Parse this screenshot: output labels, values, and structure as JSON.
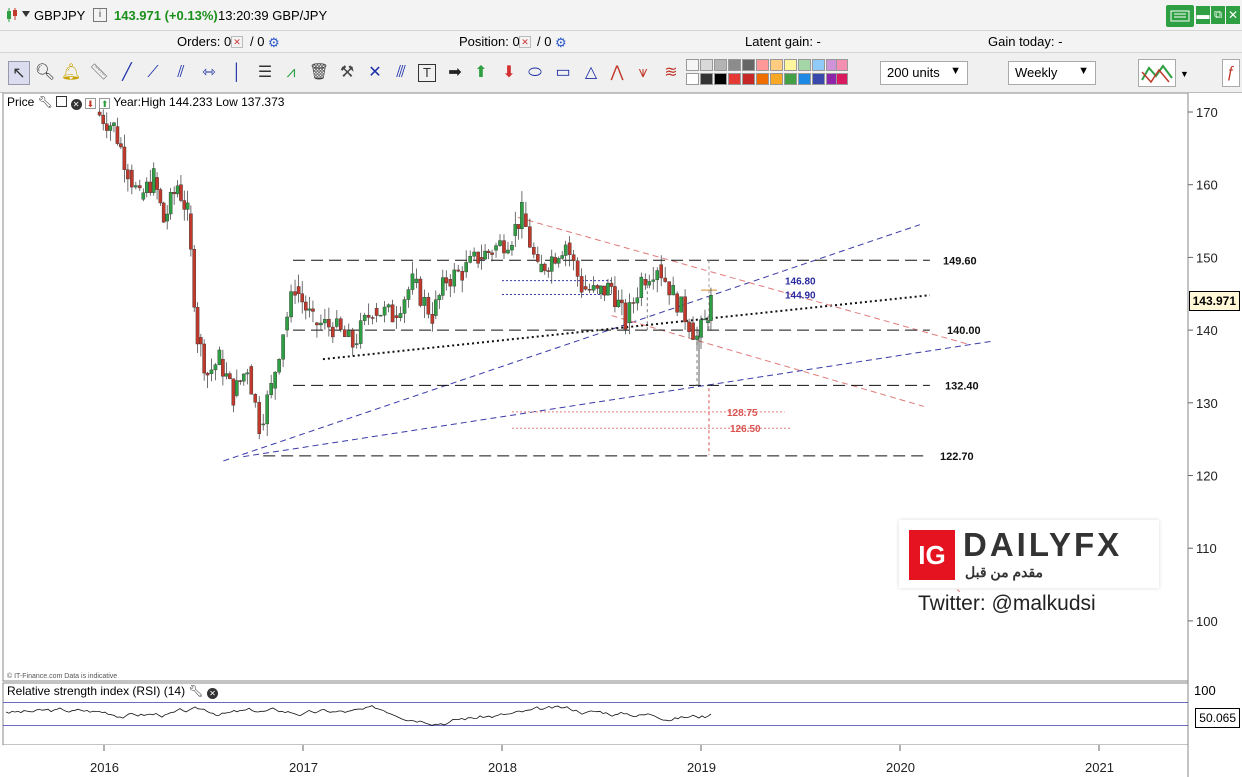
{
  "header": {
    "symbol": "GBPJPY",
    "price_change": "143.971 (+0.13%)",
    "time": "13:20:39 GBP/JPY"
  },
  "infobar": {
    "orders_label": "Orders: 0",
    "orders_sep": "/ 0",
    "position_label": "Position: 0",
    "position_sep": "/ 0",
    "latent_gain": "Latent gain: -",
    "gain_today": "Gain today: -"
  },
  "toolbar": {
    "units_select": "200 units",
    "period_select": "Weekly"
  },
  "price_panel": {
    "label": "Price",
    "year_stats": "Year:High 144.233 Low 137.373",
    "credit": "© IT-Finance.com  Data is indicative",
    "current_price": "143.971"
  },
  "rsi_panel": {
    "label": "Relative strength index (RSI) (14)",
    "axis_top": "100",
    "current_value": "50.065"
  },
  "watermark": {
    "ig": "IG",
    "brand": "DAILYFX",
    "subtitle": "مقدم من قبل",
    "twitter": "Twitter: @malkudsi"
  },
  "colors": {
    "up_candle": "#2ea043",
    "down_candle": "#c0392b",
    "trend_blue": "#3a3aa8",
    "channel_red": "#e07b7b",
    "accent_green": "#1a8f1a"
  },
  "chart_data": {
    "type": "candlestick",
    "symbol": "GBPJPY",
    "timeframe": "Weekly",
    "x_tick_labels": [
      "2016",
      "2017",
      "2018",
      "2019",
      "2020",
      "2021"
    ],
    "y_tick_labels": [
      170,
      160,
      150,
      140,
      130,
      120,
      110,
      100
    ],
    "ylim": [
      96,
      172
    ],
    "current_price": 143.971,
    "horizontal_levels": [
      {
        "label": "149.60",
        "value": 149.6,
        "style": "dashed-black"
      },
      {
        "label": "146.80",
        "value": 146.8,
        "style": "dotted-blue"
      },
      {
        "label": "144.90",
        "value": 144.9,
        "style": "dotted-blue"
      },
      {
        "label": "140.00",
        "value": 140.0,
        "style": "dashed-black"
      },
      {
        "label": "132.40",
        "value": 132.4,
        "style": "dashed-black"
      },
      {
        "label": "128.75",
        "value": 128.75,
        "style": "dotted-red"
      },
      {
        "label": "126.50",
        "value": 126.5,
        "style": "dotted-red"
      },
      {
        "label": "122.70",
        "value": 122.7,
        "style": "dashed-black"
      }
    ],
    "closes_approx": [
      {
        "t": 2015.96,
        "v": 170.0
      },
      {
        "t": 2016.05,
        "v": 168.0
      },
      {
        "t": 2016.12,
        "v": 162.0
      },
      {
        "t": 2016.18,
        "v": 158.0
      },
      {
        "t": 2016.25,
        "v": 161.0
      },
      {
        "t": 2016.3,
        "v": 155.0
      },
      {
        "t": 2016.37,
        "v": 160.0
      },
      {
        "t": 2016.42,
        "v": 156.0
      },
      {
        "t": 2016.47,
        "v": 139.0
      },
      {
        "t": 2016.52,
        "v": 134.0
      },
      {
        "t": 2016.58,
        "v": 136.0
      },
      {
        "t": 2016.65,
        "v": 131.0
      },
      {
        "t": 2016.72,
        "v": 135.0
      },
      {
        "t": 2016.78,
        "v": 127.0
      },
      {
        "t": 2016.84,
        "v": 132.0
      },
      {
        "t": 2016.9,
        "v": 140.0
      },
      {
        "t": 2016.96,
        "v": 146.0
      },
      {
        "t": 2017.05,
        "v": 141.0
      },
      {
        "t": 2017.15,
        "v": 140.5
      },
      {
        "t": 2017.25,
        "v": 138.0
      },
      {
        "t": 2017.35,
        "v": 143.0
      },
      {
        "t": 2017.45,
        "v": 142.0
      },
      {
        "t": 2017.55,
        "v": 146.5
      },
      {
        "t": 2017.65,
        "v": 142.0
      },
      {
        "t": 2017.72,
        "v": 147.0
      },
      {
        "t": 2017.8,
        "v": 148.0
      },
      {
        "t": 2017.88,
        "v": 150.0
      },
      {
        "t": 2017.95,
        "v": 151.0
      },
      {
        "t": 2018.05,
        "v": 153.0
      },
      {
        "t": 2018.1,
        "v": 156.0
      },
      {
        "t": 2018.18,
        "v": 148.0
      },
      {
        "t": 2018.25,
        "v": 150.0
      },
      {
        "t": 2018.32,
        "v": 152.0
      },
      {
        "t": 2018.4,
        "v": 146.0
      },
      {
        "t": 2018.48,
        "v": 145.0
      },
      {
        "t": 2018.55,
        "v": 146.0
      },
      {
        "t": 2018.62,
        "v": 141.0
      },
      {
        "t": 2018.7,
        "v": 147.0
      },
      {
        "t": 2018.78,
        "v": 149.0
      },
      {
        "t": 2018.86,
        "v": 145.0
      },
      {
        "t": 2018.94,
        "v": 141.0
      },
      {
        "t": 2018.98,
        "v": 139.0
      },
      {
        "t": 2019.02,
        "v": 141.0
      },
      {
        "t": 2019.05,
        "v": 143.97
      }
    ],
    "rsi": {
      "name": "RSI (14)",
      "current": 50.065,
      "upper_band": 70,
      "lower_band": 30
    }
  }
}
